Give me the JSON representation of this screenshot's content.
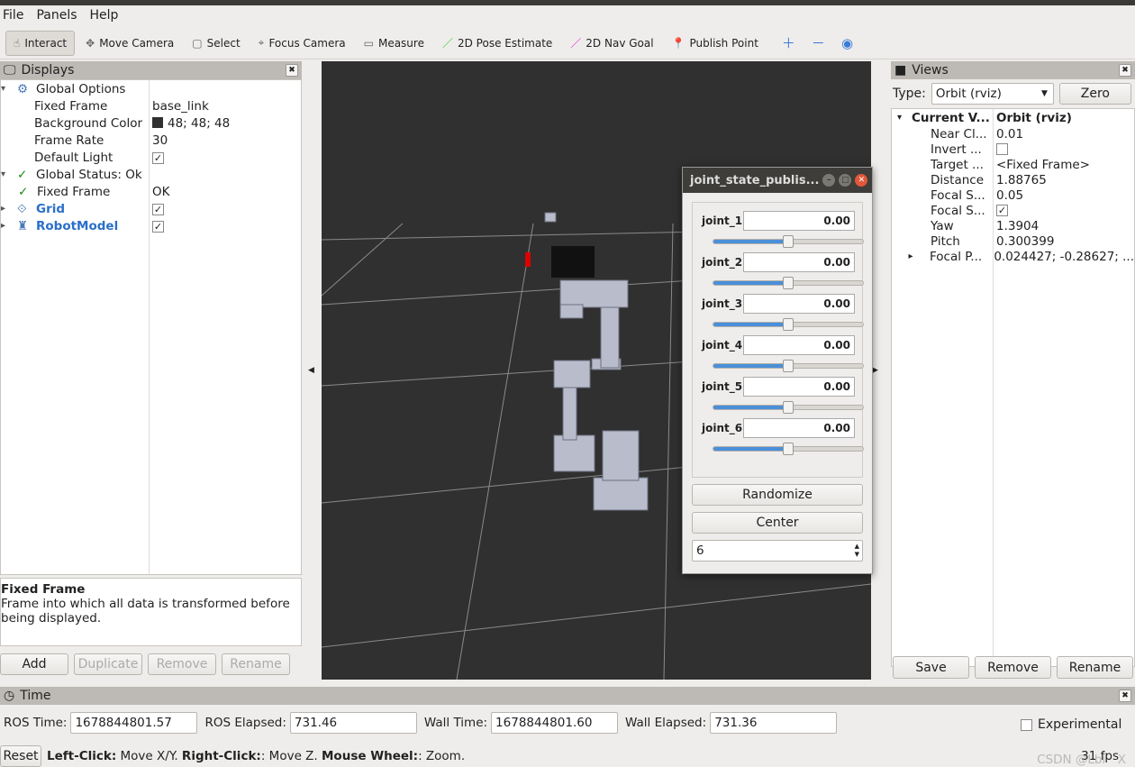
{
  "menu": [
    "File",
    "Panels",
    "Help"
  ],
  "toolbar": {
    "tools": [
      {
        "label": "Interact",
        "icon": "hand-icon",
        "active": true
      },
      {
        "label": "Move Camera",
        "icon": "move-camera-icon"
      },
      {
        "label": "Select",
        "icon": "select-icon"
      },
      {
        "label": "Focus Camera",
        "icon": "focus-camera-icon"
      },
      {
        "label": "Measure",
        "icon": "ruler-icon"
      },
      {
        "label": "2D Pose Estimate",
        "icon": "green-arrow-icon",
        "color": "#22cc22"
      },
      {
        "label": "2D Nav Goal",
        "icon": "magenta-arrow-icon",
        "color": "#dd22cc"
      },
      {
        "label": "Publish Point",
        "icon": "map-pin-icon",
        "color": "#c0392b"
      }
    ]
  },
  "displays": {
    "title": "Displays",
    "rows": [
      {
        "label": "Global Options",
        "value": "",
        "indent": 0,
        "expand": "▾",
        "icon": "⚙"
      },
      {
        "label": "Fixed Frame",
        "value": "base_link",
        "indent": 2
      },
      {
        "label": "Background Color",
        "value": "48; 48; 48",
        "indent": 2,
        "swatch": "#303030"
      },
      {
        "label": "Frame Rate",
        "value": "30",
        "indent": 2
      },
      {
        "label": "Default Light",
        "value": "✓",
        "indent": 2,
        "check": true
      },
      {
        "label": "Global Status: Ok",
        "value": "",
        "indent": 0,
        "expand": "▾",
        "icon": "✓"
      },
      {
        "label": "Fixed Frame",
        "value": "OK",
        "indent": 1,
        "icon": "✓"
      },
      {
        "label": "Grid",
        "value": "✓",
        "indent": 0,
        "expand": "▸",
        "icon": "⟐",
        "blue": true,
        "check": true
      },
      {
        "label": "RobotModel",
        "value": "✓",
        "indent": 0,
        "expand": "▸",
        "icon": "♜",
        "blue": true,
        "check": true
      }
    ],
    "help_title": "Fixed Frame",
    "help_text": "Frame into which all data is transformed before being displayed.",
    "buttons": [
      "Add",
      "Duplicate",
      "Remove",
      "Rename"
    ]
  },
  "views": {
    "title": "Views",
    "type_label": "Type:",
    "type_value": "Orbit (rviz)",
    "zero": "Zero",
    "header": {
      "label": "Current V...",
      "value": "Orbit (rviz)"
    },
    "rows": [
      {
        "label": "Near Cl...",
        "value": "0.01"
      },
      {
        "label": "Invert ...",
        "value": "",
        "check": true
      },
      {
        "label": "Target ...",
        "value": "<Fixed Frame>"
      },
      {
        "label": "Distance",
        "value": "1.88765"
      },
      {
        "label": "Focal S...",
        "value": "0.05"
      },
      {
        "label": "Focal S...",
        "value": "✓",
        "check": true
      },
      {
        "label": "Yaw",
        "value": "1.3904"
      },
      {
        "label": "Pitch",
        "value": "0.300399"
      },
      {
        "label": "Focal P...",
        "value": "0.024427; -0.28627; ...",
        "expand": "▸"
      }
    ],
    "buttons": [
      "Save",
      "Remove",
      "Rename"
    ]
  },
  "joint_panel": {
    "title": "joint_state_publis...",
    "joints": [
      {
        "name": "joint_1",
        "value": "0.00",
        "fraction": 0.5
      },
      {
        "name": "joint_2",
        "value": "0.00",
        "fraction": 0.5
      },
      {
        "name": "joint_3",
        "value": "0.00",
        "fraction": 0.5
      },
      {
        "name": "joint_4",
        "value": "0.00",
        "fraction": 0.5
      },
      {
        "name": "joint_5",
        "value": "0.00",
        "fraction": 0.5
      },
      {
        "name": "joint_6",
        "value": "0.00",
        "fraction": 0.5
      }
    ],
    "randomize": "Randomize",
    "center": "Center",
    "spin_value": "6"
  },
  "time": {
    "title": "Time",
    "ros_time_label": "ROS Time:",
    "ros_time": "1678844801.57",
    "ros_elapsed_label": "ROS Elapsed:",
    "ros_elapsed": "731.46",
    "wall_time_label": "Wall Time:",
    "wall_time": "1678844801.60",
    "wall_elapsed_label": "Wall Elapsed:",
    "wall_elapsed": "731.36",
    "experimental": "Experimental"
  },
  "status": {
    "reset": "Reset",
    "b1": "Left-Click:",
    "t1": " Move X/Y. ",
    "b2": "Right-Click:",
    "t2": ": Move Z. ",
    "b3": "Mouse Wheel:",
    "t3": ": Zoom.",
    "fps": "31 fps",
    "watermark": "CSDN @Lbi　X"
  }
}
